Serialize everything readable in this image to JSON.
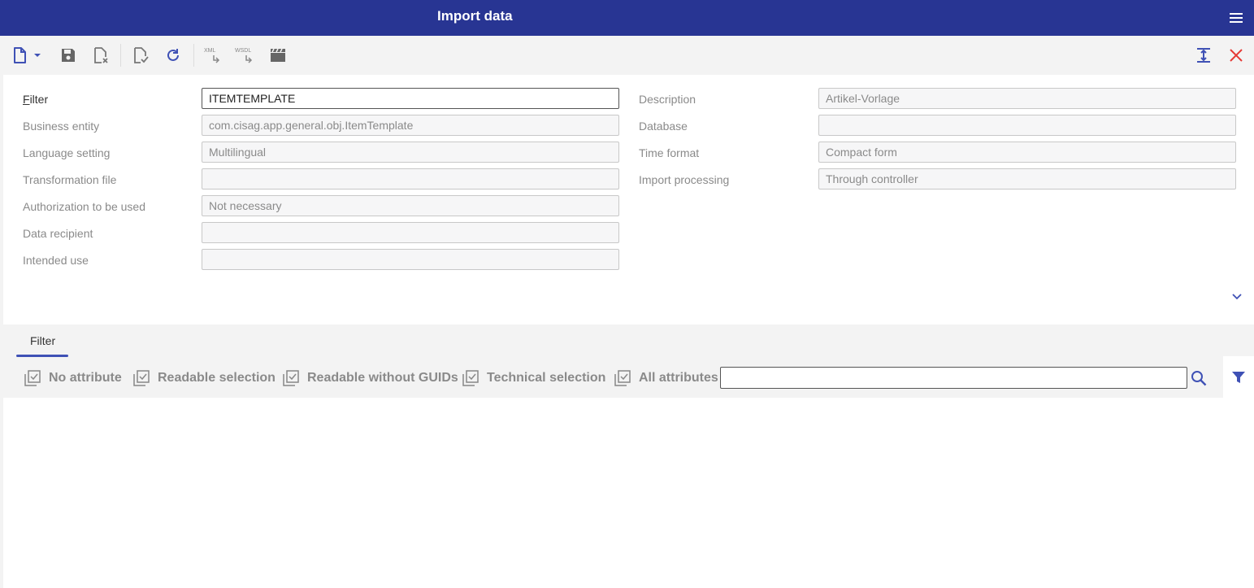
{
  "app": {
    "title": "Import data"
  },
  "colors": {
    "header": "#283593",
    "accent": "#3f51b5",
    "close": "#e53935"
  },
  "toolbar": {
    "icons": [
      "new-document-icon",
      "dropdown-arrow-icon",
      "save-icon",
      "discard-icon",
      "validate-icon",
      "refresh-icon",
      "xml-export-icon",
      "wsdl-export-icon",
      "clapperboard-icon",
      "expand-vertical-icon",
      "close-icon"
    ],
    "xml_label": "XML",
    "wsdl_label": "WSDL"
  },
  "form": {
    "filter": {
      "label_first": "F",
      "label_rest": "ilter",
      "value": "ITEMTEMPLATE"
    },
    "business_entity": {
      "label": "Business entity",
      "value": "com.cisag.app.general.obj.ItemTemplate"
    },
    "language_setting": {
      "label": "Language setting",
      "value": "Multilingual"
    },
    "transformation_file": {
      "label": "Transformation file",
      "value": ""
    },
    "authorization": {
      "label": "Authorization to be used",
      "value": "Not necessary"
    },
    "data_recipient": {
      "label": "Data recipient",
      "value": ""
    },
    "intended_use": {
      "label": "Intended use",
      "value": ""
    },
    "description": {
      "label": "Description",
      "value": "Artikel-Vorlage"
    },
    "database": {
      "label": "Database",
      "value": ""
    },
    "time_format": {
      "label": "Time format",
      "value": "Compact form"
    },
    "import_processing": {
      "label": "Import processing",
      "value": "Through controller"
    }
  },
  "tabs": [
    {
      "label": "Filter"
    }
  ],
  "filter_options": [
    {
      "label": "No attribute"
    },
    {
      "label": "Readable selection"
    },
    {
      "label": "Readable without GUIDs"
    },
    {
      "label": "Technical selection"
    },
    {
      "label": "All attributes"
    }
  ],
  "search": {
    "value": "",
    "placeholder": ""
  }
}
